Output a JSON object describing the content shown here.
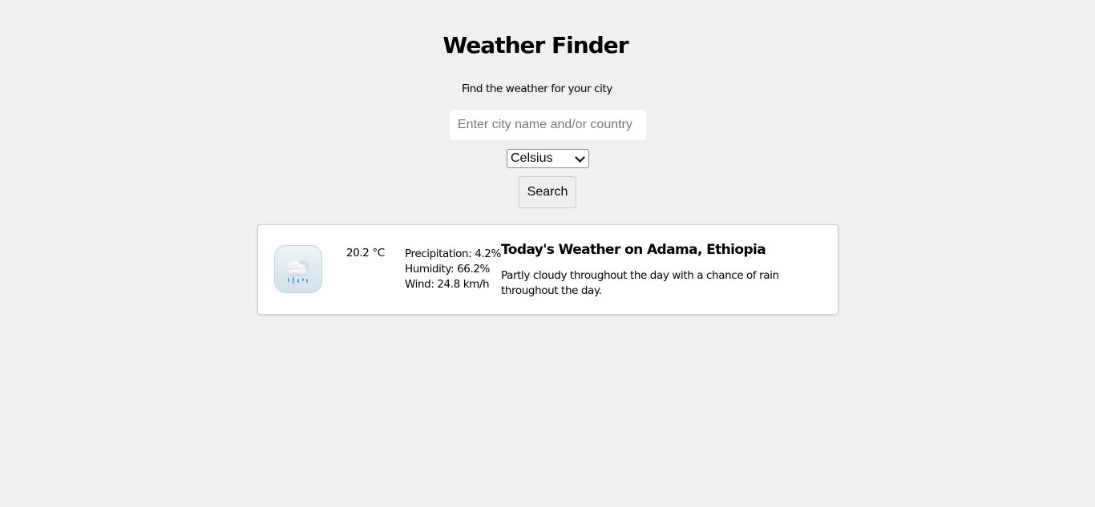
{
  "header": {
    "title": "Weather Finder",
    "subtitle": "Find the weather for your city"
  },
  "search": {
    "value": "",
    "placeholder": "Enter city name and/or country",
    "unit_selected": "Celsius",
    "button_label": "Search"
  },
  "result": {
    "icon": "rain-cloud-icon",
    "temperature": "20.2 °C",
    "precipitation": "Precipitation: 4.2%",
    "humidity": "Humidity: 66.2%",
    "wind": "Wind: 24.8 km/h",
    "headline": "Today's Weather on Adama, Ethiopia",
    "description": "Partly cloudy throughout the day with a chance of rain throughout the day."
  },
  "colors": {
    "background": "#f0f0f0",
    "card": "#ffffff",
    "rain": "#2f9be0"
  }
}
